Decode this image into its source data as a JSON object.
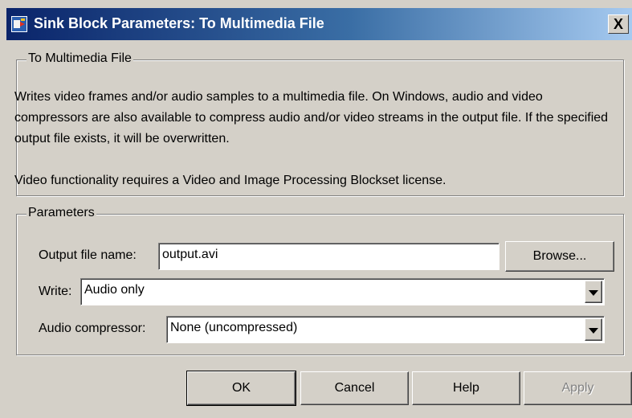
{
  "window": {
    "title": "Sink Block Parameters: To Multimedia File",
    "close_label": "X",
    "icon": "simulink-block-icon"
  },
  "description_group": {
    "legend": "To Multimedia File",
    "paragraph1": "Writes video frames and/or audio samples to a multimedia file. On Windows, audio and video compressors are also available to compress audio and/or video streams in the output file. If the specified output file exists, it will be overwritten.",
    "paragraph2": "Video functionality requires a Video and Image Processing Blockset license."
  },
  "parameters": {
    "legend": "Parameters",
    "output_file_label": "Output file name:",
    "output_file_value": "output.avi",
    "browse_label": "Browse...",
    "write_label": "Write:",
    "write_value": "Audio only",
    "audio_compressor_label": "Audio compressor:",
    "audio_compressor_value": "None (uncompressed)"
  },
  "buttons": {
    "ok": "OK",
    "cancel": "Cancel",
    "help": "Help",
    "apply": "Apply"
  }
}
